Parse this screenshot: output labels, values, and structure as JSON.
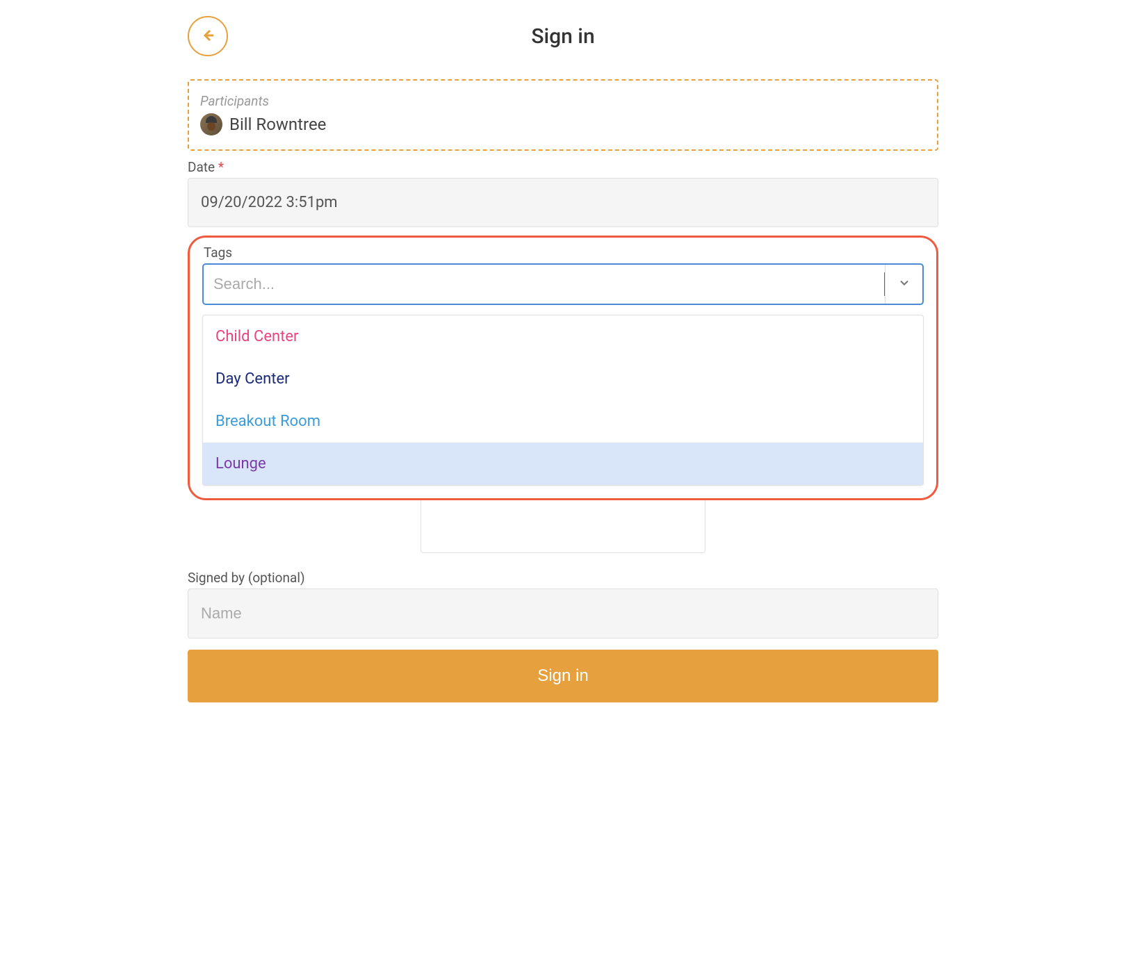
{
  "header": {
    "title": "Sign in"
  },
  "participants": {
    "label": "Participants",
    "items": [
      {
        "name": "Bill Rowntree"
      }
    ]
  },
  "date": {
    "label": "Date",
    "required": "*",
    "value": "09/20/2022 3:51pm"
  },
  "tags": {
    "label": "Tags",
    "search_placeholder": "Search...",
    "options": [
      {
        "label": "Child Center",
        "color": "#e8447f",
        "highlighted": false
      },
      {
        "label": "Day Center",
        "color": "#1a2b7a",
        "highlighted": false
      },
      {
        "label": "Breakout Room",
        "color": "#3c9cd9",
        "highlighted": false
      },
      {
        "label": "Lounge",
        "color": "#7a3ba8",
        "highlighted": true
      }
    ]
  },
  "signed_by": {
    "label": "Signed by (optional)",
    "placeholder": "Name"
  },
  "submit": {
    "label": "Sign in"
  }
}
